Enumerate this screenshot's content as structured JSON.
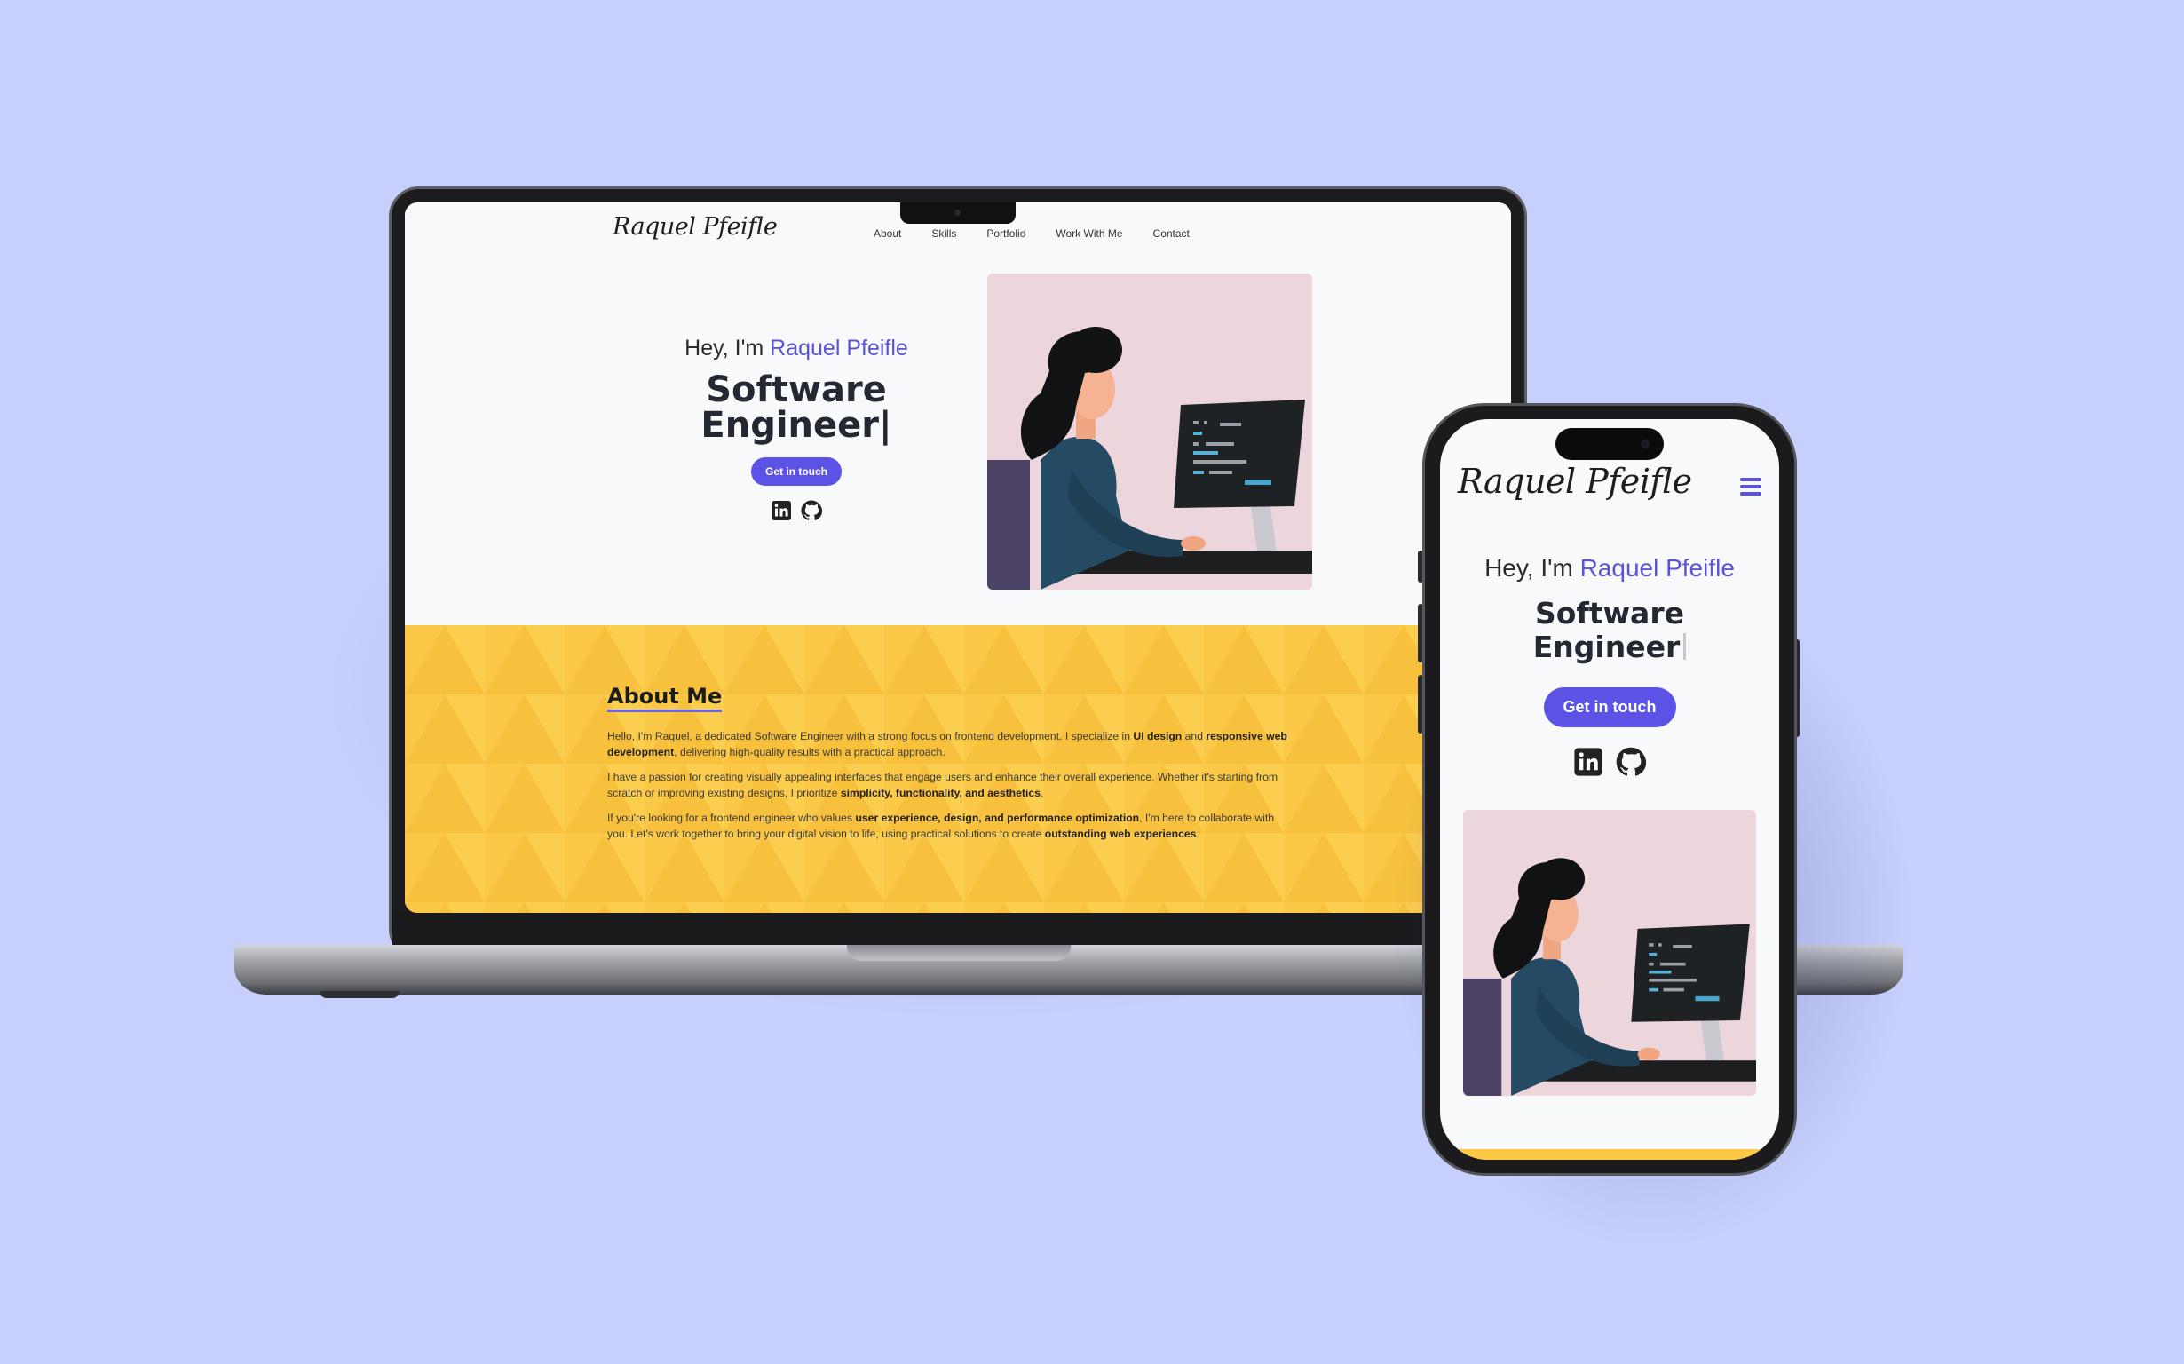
{
  "site": {
    "logo": "Raquel Pfeifle",
    "nav": [
      "About",
      "Skills",
      "Portfolio",
      "Work With Me",
      "Contact"
    ],
    "hero": {
      "greeting": "Hey, I'm ",
      "name": "Raquel Pfeifle",
      "title_line1": "Software",
      "title_line2": "Engineer",
      "cursor": "|",
      "cta": "Get in touch"
    },
    "socials": [
      "linkedin-icon",
      "github-icon"
    ],
    "about": {
      "title": "About Me",
      "p1_a": "Hello, I'm Raquel, a dedicated Software Engineer with a strong focus on frontend development. I specialize in ",
      "p1_b": "UI design",
      "p1_c": " and ",
      "p1_d": "responsive web development",
      "p1_e": ", delivering high-quality results with a practical approach.",
      "p2_a": "I have a passion for creating visually appealing interfaces that engage users and enhance their overall experience. Whether it's starting from scratch or improving existing designs, I prioritize ",
      "p2_b": "simplicity, functionality, and aesthetics",
      "p2_c": ".",
      "p3_a": "If you're looking for a frontend engineer who values ",
      "p3_b": "user experience, design, and performance optimization",
      "p3_c": ", I'm here to collaborate with you. Let's work together to bring your digital vision to life, using practical solutions to create ",
      "p3_d": "outstanding web experiences",
      "p3_e": "."
    }
  },
  "colors": {
    "background": "#c7d0fd",
    "accent": "#5b54d6",
    "button": "#5c53e6",
    "about_bg": "#fcc944",
    "illustration_bg": "#ecd6dc"
  }
}
